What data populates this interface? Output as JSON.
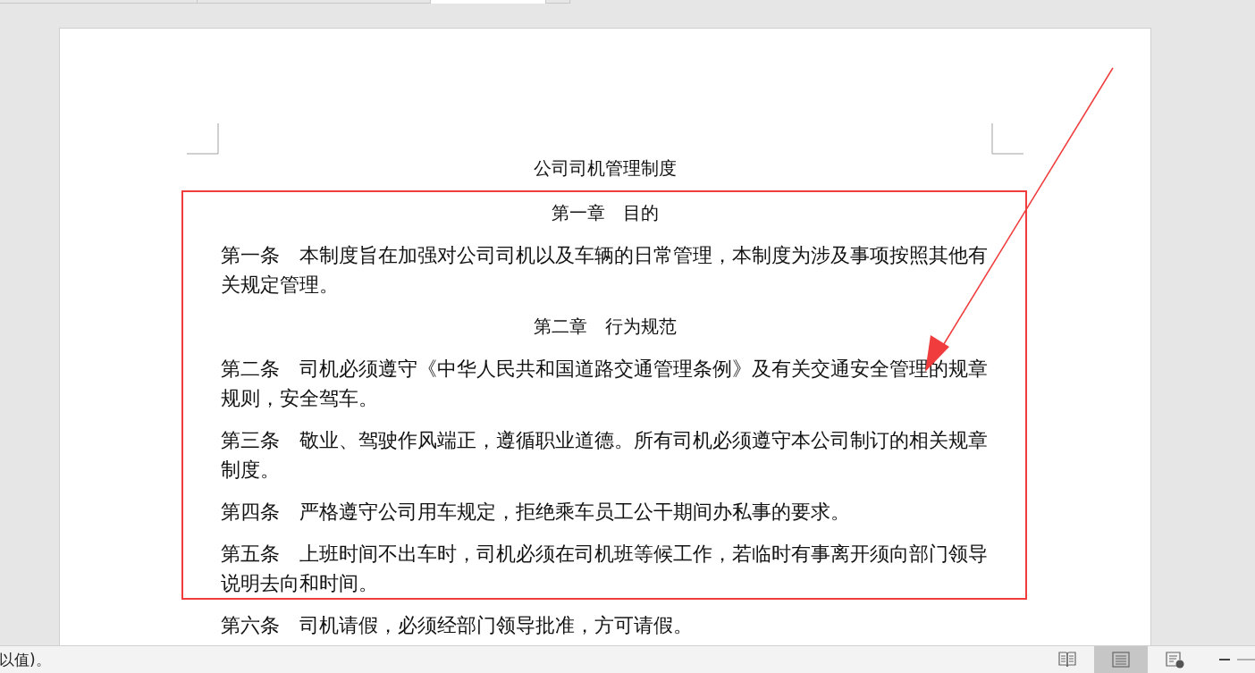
{
  "document": {
    "title": "公司司机管理制度",
    "blocks": [
      {
        "kind": "heading",
        "text": "第一章　目的"
      },
      {
        "kind": "paragraph",
        "text": "第一条　本制度旨在加强对公司司机以及车辆的日常管理，本制度为涉及事项按照其他有关规定管理。"
      },
      {
        "kind": "heading",
        "text": "第二章　行为规范"
      },
      {
        "kind": "paragraph",
        "text": "第二条　司机必须遵守《中华人民共和国道路交通管理条例》及有关交通安全管理的规章规则，安全驾车。"
      },
      {
        "kind": "paragraph",
        "text": "第三条　敬业、驾驶作风端正，遵循职业道德。所有司机必须遵守本公司制订的相关规章制度。"
      },
      {
        "kind": "paragraph",
        "text": "第四条　严格遵守公司用车规定，拒绝乘车员工公干期间办私事的要求。"
      },
      {
        "kind": "paragraph",
        "text": "第五条　上班时间不出车时，司机必须在司机班等候工作，若临时有事离开须向部门领导说明去向和时间。"
      },
      {
        "kind": "paragraph",
        "text": "第六条　司机请假，必须经部门领导批准，方可请假。"
      }
    ]
  },
  "status_bar": {
    "text": "以值)。",
    "views": [
      {
        "kind": "read",
        "selected": false
      },
      {
        "kind": "print",
        "selected": true
      },
      {
        "kind": "web",
        "selected": false
      }
    ]
  }
}
